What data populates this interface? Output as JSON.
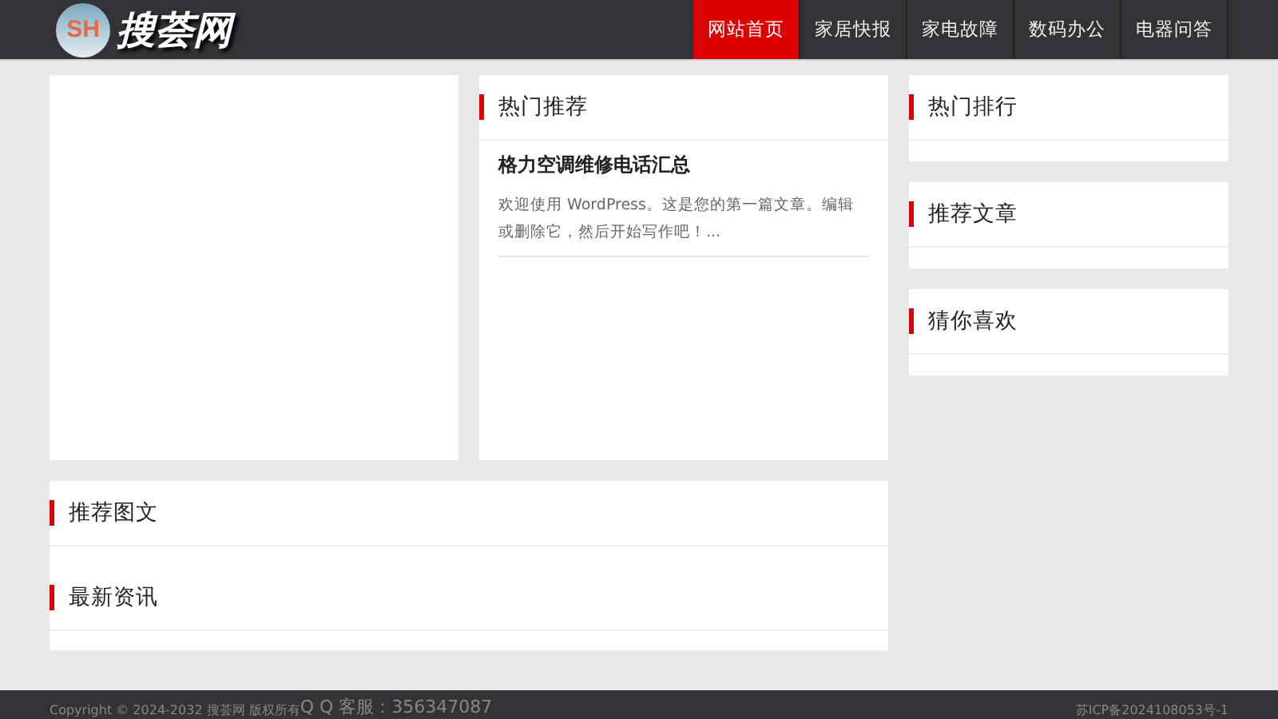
{
  "header": {
    "logo": {
      "badge": "SH",
      "name": "搜荟网"
    },
    "nav": [
      {
        "label": "网站首页",
        "selected": true
      },
      {
        "label": "家居快报",
        "selected": false
      },
      {
        "label": "家电故障",
        "selected": false
      },
      {
        "label": "数码办公",
        "selected": false
      },
      {
        "label": "电器问答",
        "selected": false
      }
    ]
  },
  "hot": {
    "title": "热门推荐",
    "posts": [
      {
        "title": "格力空调维修电话汇总",
        "excerpt": "欢迎使用 WordPress。这是您的第一篇文章。编辑或删除它，然后开始写作吧！..."
      }
    ]
  },
  "sections": [
    {
      "title": "推荐图文"
    },
    {
      "title": "最新资讯"
    }
  ],
  "sidebar": [
    {
      "title": "热门排行"
    },
    {
      "title": "推荐文章"
    },
    {
      "title": "猜你喜欢"
    }
  ],
  "footer": {
    "copyright": "Copyright © 2024-2032 搜荟网 版权所有",
    "qq": "Q Q 客服：356347087",
    "icp": "苏ICP备2024108053号-1"
  }
}
